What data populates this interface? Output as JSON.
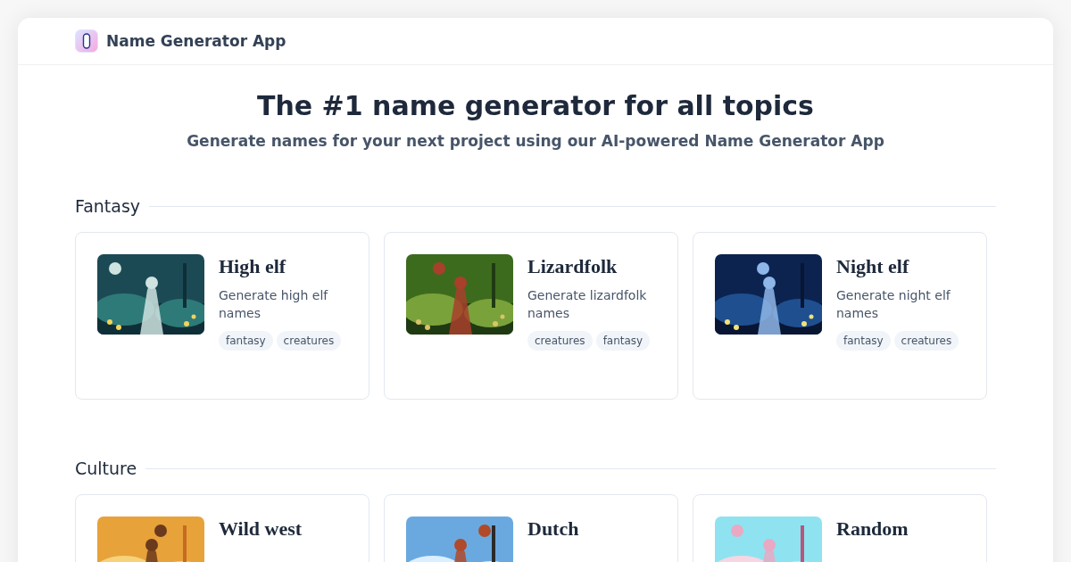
{
  "header": {
    "app_name": "Name Generator App"
  },
  "hero": {
    "title": "The #1 name generator for all topics",
    "subtitle": "Generate names for your next project using our AI-powered Name Generator App"
  },
  "sections": [
    {
      "title": "Fantasy",
      "cards": [
        {
          "title": "High elf",
          "description": "Generate high elf names",
          "tags": [
            "fantasy",
            "creatures"
          ],
          "image": {
            "kind": "picture"
          }
        },
        {
          "title": "Lizardfolk",
          "description": "Generate lizardfolk names",
          "tags": [
            "creatures",
            "fantasy"
          ],
          "image": {
            "kind": "picture"
          }
        },
        {
          "title": "Night elf",
          "description": "Generate night elf names",
          "tags": [
            "fantasy",
            "creatures"
          ],
          "image": {
            "kind": "picture"
          }
        }
      ]
    },
    {
      "title": "Culture",
      "cards": [
        {
          "title": "Wild west",
          "image": {
            "kind": "picture"
          }
        },
        {
          "title": "Dutch",
          "image": {
            "kind": "picture"
          }
        },
        {
          "title": "Random",
          "image": {
            "kind": "picture"
          }
        }
      ]
    }
  ]
}
